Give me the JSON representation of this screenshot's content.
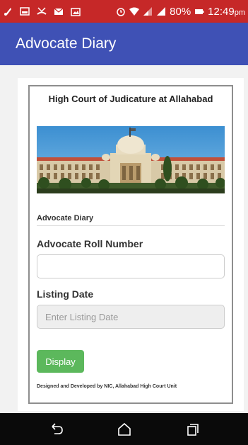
{
  "status_bar": {
    "battery": "80%",
    "time": "12:49",
    "time_suffix": "pm",
    "icons": [
      "app-notification-icon",
      "gallery-icon",
      "missed-call-icon",
      "email-icon",
      "image-icon",
      "alarm-icon",
      "wifi-icon",
      "signal-icon",
      "signal-icon",
      "battery-icon"
    ]
  },
  "app_bar": {
    "title": "Advocate Diary"
  },
  "panel": {
    "court_title": "High Court of Judicature at Allahabad",
    "banner_image": "high-court-building",
    "section_label": "Advocate Diary",
    "roll_label": "Advocate Roll Number",
    "roll_value": "",
    "date_label": "Listing Date",
    "date_placeholder": "Enter Listing Date",
    "display_button": "Display",
    "credit": "Designed and Developed by NIC, Allahabad High Court Unit"
  },
  "nav_bar": {
    "icons": [
      "back-icon",
      "home-icon",
      "recents-icon"
    ]
  },
  "colors": {
    "status_bar": "#c62828",
    "app_bar": "#3f51b5",
    "button": "#5cb85c"
  }
}
